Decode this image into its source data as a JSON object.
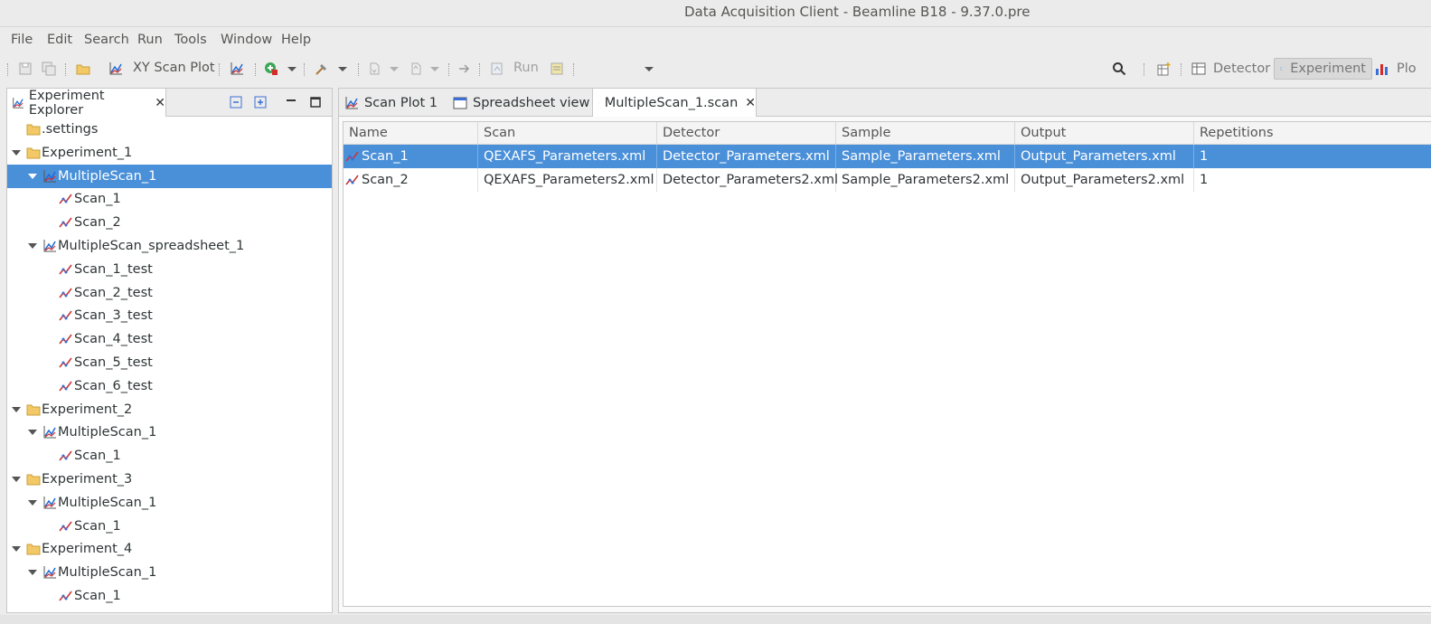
{
  "window": {
    "title": "Data Acquisition Client - Beamline B18 - 9.37.0.pre"
  },
  "menu": [
    "File",
    "Edit",
    "Search",
    "Run",
    "Tools",
    "Window",
    "Help"
  ],
  "toolbar": {
    "xy_scan_plot_label": "XY Scan Plot",
    "run_label": "Run",
    "perspectives": [
      {
        "label": "Detector",
        "active": false
      },
      {
        "label": "Experiment",
        "active": true
      },
      {
        "label": "Plo",
        "active": false
      }
    ]
  },
  "explorer": {
    "tab_label": "Experiment Explorer",
    "tree": [
      {
        "label": ".settings",
        "type": "folder",
        "level": 0,
        "expanded": null,
        "selected": false
      },
      {
        "label": "Experiment_1",
        "type": "folder",
        "level": 0,
        "expanded": true,
        "selected": false
      },
      {
        "label": "MultipleScan_1",
        "type": "multiscan",
        "level": 1,
        "expanded": true,
        "selected": true
      },
      {
        "label": "Scan_1",
        "type": "scan",
        "level": 2,
        "expanded": null,
        "selected": false
      },
      {
        "label": "Scan_2",
        "type": "scan",
        "level": 2,
        "expanded": null,
        "selected": false
      },
      {
        "label": "MultipleScan_spreadsheet_1",
        "type": "multiscan",
        "level": 1,
        "expanded": true,
        "selected": false
      },
      {
        "label": "Scan_1_test",
        "type": "scan",
        "level": 2,
        "expanded": null,
        "selected": false
      },
      {
        "label": "Scan_2_test",
        "type": "scan",
        "level": 2,
        "expanded": null,
        "selected": false
      },
      {
        "label": "Scan_3_test",
        "type": "scan",
        "level": 2,
        "expanded": null,
        "selected": false
      },
      {
        "label": "Scan_4_test",
        "type": "scan",
        "level": 2,
        "expanded": null,
        "selected": false
      },
      {
        "label": "Scan_5_test",
        "type": "scan",
        "level": 2,
        "expanded": null,
        "selected": false
      },
      {
        "label": "Scan_6_test",
        "type": "scan",
        "level": 2,
        "expanded": null,
        "selected": false
      },
      {
        "label": "Experiment_2",
        "type": "folder",
        "level": 0,
        "expanded": true,
        "selected": false
      },
      {
        "label": "MultipleScan_1",
        "type": "multiscan",
        "level": 1,
        "expanded": true,
        "selected": false
      },
      {
        "label": "Scan_1",
        "type": "scan",
        "level": 2,
        "expanded": null,
        "selected": false
      },
      {
        "label": "Experiment_3",
        "type": "folder",
        "level": 0,
        "expanded": true,
        "selected": false
      },
      {
        "label": "MultipleScan_1",
        "type": "multiscan",
        "level": 1,
        "expanded": true,
        "selected": false
      },
      {
        "label": "Scan_1",
        "type": "scan",
        "level": 2,
        "expanded": null,
        "selected": false
      },
      {
        "label": "Experiment_4",
        "type": "folder",
        "level": 0,
        "expanded": true,
        "selected": false
      },
      {
        "label": "MultipleScan_1",
        "type": "multiscan",
        "level": 1,
        "expanded": true,
        "selected": false
      },
      {
        "label": "Scan_1",
        "type": "scan",
        "level": 2,
        "expanded": null,
        "selected": false
      }
    ]
  },
  "editor": {
    "tabs": [
      {
        "label": "Scan Plot 1",
        "active": false
      },
      {
        "label": "Spreadsheet view",
        "active": false
      },
      {
        "label": "MultipleScan_1.scan",
        "active": true
      }
    ],
    "table": {
      "columns": [
        "Name",
        "Scan",
        "Detector",
        "Sample",
        "Output",
        "Repetitions"
      ],
      "rows": [
        {
          "selected": true,
          "cells": [
            "Scan_1",
            "QEXAFS_Parameters.xml",
            "Detector_Parameters.xml",
            "Sample_Parameters.xml",
            "Output_Parameters.xml",
            "1"
          ]
        },
        {
          "selected": false,
          "cells": [
            "Scan_2",
            "QEXAFS_Parameters2.xml",
            "Detector_Parameters2.xml",
            "Sample_Parameters2.xml",
            "Output_Parameters2.xml",
            "1"
          ]
        }
      ]
    }
  }
}
